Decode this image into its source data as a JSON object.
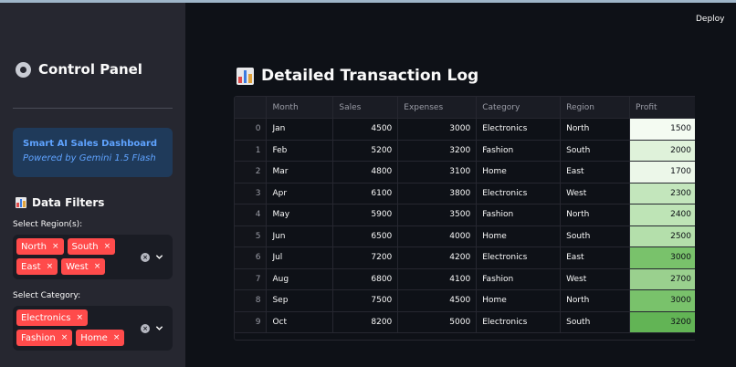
{
  "app": {
    "deploy_label": "Deploy"
  },
  "sidebar": {
    "title": "Control Panel",
    "info": {
      "title": "Smart AI Sales Dashboard",
      "subtitle": "Powered by Gemini 1.5 Flash"
    },
    "filters_title": "Data Filters",
    "region": {
      "label": "Select Region(s):",
      "tags": [
        "North",
        "South",
        "East",
        "West"
      ]
    },
    "category": {
      "label": "Select Category:",
      "tags": [
        "Electronics",
        "Fashion",
        "Home"
      ]
    },
    "tag_remove_glyph": "×",
    "clear_glyph": "×"
  },
  "main": {
    "title": "Detailed Transaction Log",
    "table": {
      "columns": [
        "",
        "Month",
        "Sales",
        "Expenses",
        "Category",
        "Region",
        "Profit"
      ],
      "rows": [
        [
          "0",
          "Jan",
          "4500",
          "3000",
          "Electronics",
          "North",
          "1500"
        ],
        [
          "1",
          "Feb",
          "5200",
          "3200",
          "Fashion",
          "South",
          "2000"
        ],
        [
          "2",
          "Mar",
          "4800",
          "3100",
          "Home",
          "East",
          "1700"
        ],
        [
          "3",
          "Apr",
          "6100",
          "3800",
          "Electronics",
          "West",
          "2300"
        ],
        [
          "4",
          "May",
          "5900",
          "3500",
          "Fashion",
          "North",
          "2400"
        ],
        [
          "5",
          "Jun",
          "6500",
          "4000",
          "Home",
          "South",
          "2500"
        ],
        [
          "6",
          "Jul",
          "7200",
          "4200",
          "Electronics",
          "East",
          "3000"
        ],
        [
          "7",
          "Aug",
          "6800",
          "4100",
          "Fashion",
          "West",
          "2700"
        ],
        [
          "8",
          "Sep",
          "7500",
          "4500",
          "Home",
          "North",
          "3000"
        ],
        [
          "9",
          "Oct",
          "8200",
          "5000",
          "Electronics",
          "South",
          "3200"
        ]
      ],
      "profit_colors": [
        "#f4fbf2",
        "#dff2da",
        "#ecf7e9",
        "#c3e6bc",
        "#bee4b6",
        "#b4dfab",
        "#79c26b",
        "#9ad08e",
        "#79c26b",
        "#62b455"
      ]
    }
  },
  "colors": {
    "accent": "#ff4b4b",
    "info_text": "#5fa3ff",
    "sidebar_bg": "#262730",
    "main_bg": "#0e1117"
  }
}
